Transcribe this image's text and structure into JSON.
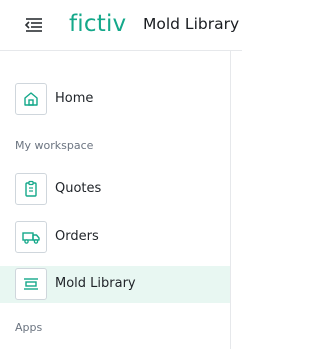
{
  "header": {
    "menu_icon": "menu-collapse-icon",
    "logo_text": "fictiv",
    "page_title": "Mold Library"
  },
  "nav": {
    "items": [
      {
        "label": "Home",
        "icon": "home-icon",
        "active": false
      },
      {
        "label": "Quotes",
        "icon": "quotes-icon",
        "active": false
      },
      {
        "label": "Orders",
        "icon": "truck-icon",
        "active": false
      },
      {
        "label": "Mold Library",
        "icon": "mold-library-icon",
        "active": true
      }
    ],
    "sections": {
      "workspace": "My workspace",
      "apps": "Apps"
    }
  },
  "colors": {
    "brand": "#14a88a",
    "active_bg": "#e8f7f2",
    "icon_stroke": "#14a88a"
  }
}
